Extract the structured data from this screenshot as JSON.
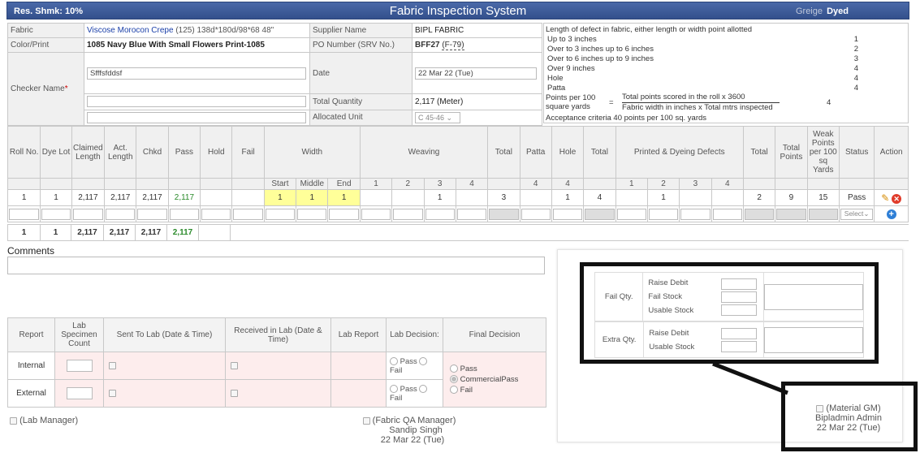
{
  "title": {
    "res_shmk": "Res. Shmk: 10%",
    "app": "Fabric Inspection System",
    "greige": "Greige",
    "dyed": "Dyed"
  },
  "info": {
    "fabric_label": "Fabric",
    "fabric_name": "Viscose Morocon Crepe",
    "fabric_spec": " (125) 138d*180d/98*68 48\"",
    "color_label": "Color/Print",
    "color_value": "1085 Navy Blue With Small Flowers Print-1085",
    "checker_label": "Checker Name",
    "checker_value": "Sfffsfddsf",
    "supplier_label": "Supplier Name",
    "supplier_value": "BIPL FABRIC",
    "po_label": "PO Number (SRV No.)",
    "po_value": "BFF27",
    "po_sub": "(F-79)",
    "date_label": "Date",
    "date_value": "22 Mar 22 (Tue)",
    "qty_label": "Total Quantity",
    "qty_value": "2,117 (Meter)",
    "unit_label": "Allocated Unit",
    "unit_value": "C 45-46"
  },
  "legend": {
    "heading": "Length of defect in fabric, either length or width point allotted",
    "rows": [
      {
        "t": "Up to 3 inches",
        "p": "1"
      },
      {
        "t": "Over to 3 inches up to 6 inches",
        "p": "2"
      },
      {
        "t": "Over to 6 inches up to 9 inches",
        "p": "3"
      },
      {
        "t": "Over 9 inches",
        "p": "4"
      },
      {
        "t": "Hole",
        "p": "4"
      },
      {
        "t": "Patta",
        "p": "4"
      }
    ],
    "ppl1": "Points per 100",
    "ppl2": "square yards",
    "eq": "=",
    "num": "Total points scored in the roll x 3600",
    "den": "Fabric width in inches x Total mtrs inspected",
    "ppv": "4",
    "accept": "Acceptance criteria 40 points per 100 sq. yards"
  },
  "grid": {
    "h": {
      "roll": "Roll No.",
      "dye": "Dye Lot",
      "claimed": "Claimed Length",
      "act": "Act. Length",
      "chkd": "Chkd",
      "pass": "Pass",
      "hold": "Hold",
      "fail": "Fail",
      "width": "Width",
      "weaving": "Weaving",
      "total": "Total",
      "patta": "Patta",
      "hole": "Hole",
      "pd": "Printed & Dyeing Defects",
      "tpoints": "Total Points",
      "weak": "Weak Points per 100 sq Yards",
      "status": "Status",
      "action": "Action"
    },
    "s": {
      "start": "Start",
      "middle": "Middle",
      "end": "End",
      "w1": "1",
      "w2": "2",
      "w3": "3",
      "w4": "4",
      "patta": "4",
      "hole": "4",
      "p1": "1",
      "p2": "2",
      "p3": "3",
      "p4": "4"
    },
    "r": {
      "roll": "1",
      "dye": "1",
      "claimed": "2,117",
      "act": "2,117",
      "chkd": "2,117",
      "pass": "2,117",
      "ws": "1",
      "wm": "1",
      "we": "1",
      "w3": "1",
      "wtotal": "3",
      "hole": "1",
      "total2": "4",
      "p2": "1",
      "total3": "2",
      "tpoints": "9",
      "weak": "15",
      "status": "Pass"
    },
    "select": "Select",
    "t": {
      "roll": "1",
      "dye": "1",
      "claimed": "2,117",
      "act": "2,117",
      "chkd": "2,117",
      "pass": "2,117"
    }
  },
  "comments_label": "Comments",
  "lab": {
    "h": {
      "report": "Report",
      "spec": "Lab Specimen Count",
      "sent": "Sent To Lab (Date & Time)",
      "recv": "Received in Lab (Date & Time)",
      "rep": "Lab Report",
      "dec": "Lab Decision:",
      "final": "Final Decision"
    },
    "r1": "Internal",
    "r2": "External",
    "pass": "Pass",
    "fail": "Fail",
    "f_pass": "Pass",
    "f_cp": "CommercialPass",
    "f_fail": "Fail"
  },
  "sign": {
    "lab_mgr": "(Lab Manager)",
    "qa": "(Fabric QA Manager)",
    "qa_name": "Sandip Singh",
    "qa_date": "22 Mar 22 (Tue)",
    "gm": "(Material GM)",
    "gm_name": "Bipladmin Admin",
    "gm_date": "22 Mar 22 (Tue)"
  },
  "fs": {
    "fail_qty": "Fail Qty.",
    "raise_debit": "Raise Debit",
    "fail_stock": "Fail Stock",
    "usable_stock": "Usable Stock",
    "extra_qty": "Extra Qty.",
    "raise_debit2": "Raise Debit",
    "usable_stock2": "Usable Stock"
  }
}
